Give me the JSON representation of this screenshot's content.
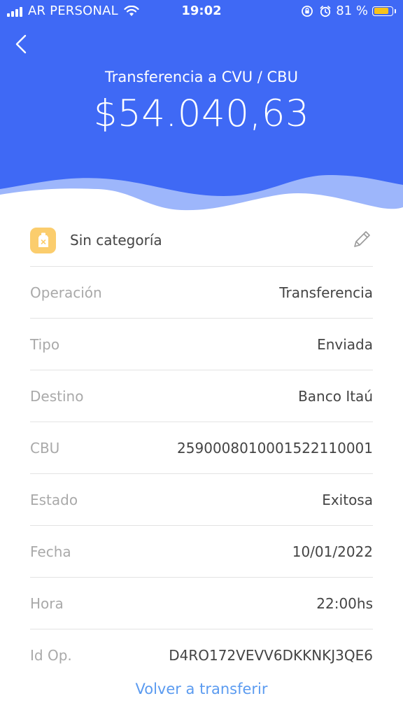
{
  "status_bar": {
    "carrier": "AR PERSONAL",
    "time": "19:02",
    "battery_percent": "81 %",
    "battery_level": 0.81
  },
  "header": {
    "title": "Transferencia a CVU / CBU",
    "amount": "$54.040,63",
    "background_color": "#3f69f5"
  },
  "category": {
    "label": "Sin categoría",
    "icon": "tag-icon",
    "edit_icon": "pencil-icon"
  },
  "details": [
    {
      "label": "Operación",
      "value": "Transferencia"
    },
    {
      "label": "Tipo",
      "value": "Enviada"
    },
    {
      "label": "Destino",
      "value": "Banco Itaú"
    },
    {
      "label": "CBU",
      "value": "2590008010001522110001"
    },
    {
      "label": "Estado",
      "value": "Exitosa"
    },
    {
      "label": "Fecha",
      "value": "10/01/2022"
    },
    {
      "label": "Hora",
      "value": "22:00hs"
    },
    {
      "label": "Id Op.",
      "value": "D4RO172VEVV6DKKNKJ3QE6"
    }
  ],
  "footer": {
    "link_label": "Volver a transferir",
    "link_color": "#5b9bf0"
  }
}
